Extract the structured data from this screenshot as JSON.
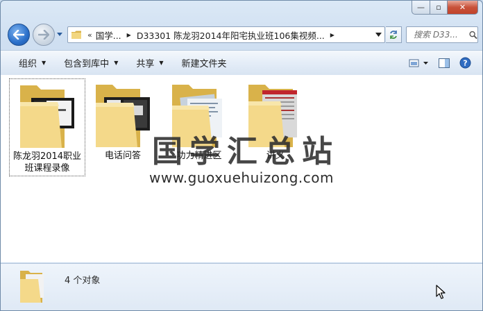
{
  "window": {
    "caption": {
      "minimize": "—",
      "maximize": "▫",
      "close": "✕"
    }
  },
  "navigation": {
    "breadcrumb": [
      "国学...",
      "D33301 陈龙羽2014年阳宅执业班106集视频..."
    ],
    "overflow_chevron": "«",
    "search_placeholder": "搜索 D33..."
  },
  "toolbar": {
    "organize": "组织",
    "include_in_library": "包含到库中",
    "share": "共享",
    "new_folder": "新建文件夹"
  },
  "items": [
    {
      "label": "陈龙羽2014职业班课程录像",
      "selected": true,
      "preview": "video"
    },
    {
      "label": "电话问答",
      "selected": false,
      "preview": "video"
    },
    {
      "label": "功力精进区",
      "selected": false,
      "preview": "document"
    },
    {
      "label": "讲义",
      "selected": false,
      "preview": "red-document"
    }
  ],
  "watermark": {
    "title": "国学汇总站",
    "url": "www.guoxuehuizong.com"
  },
  "details": {
    "count_text": "4 个对象"
  }
}
